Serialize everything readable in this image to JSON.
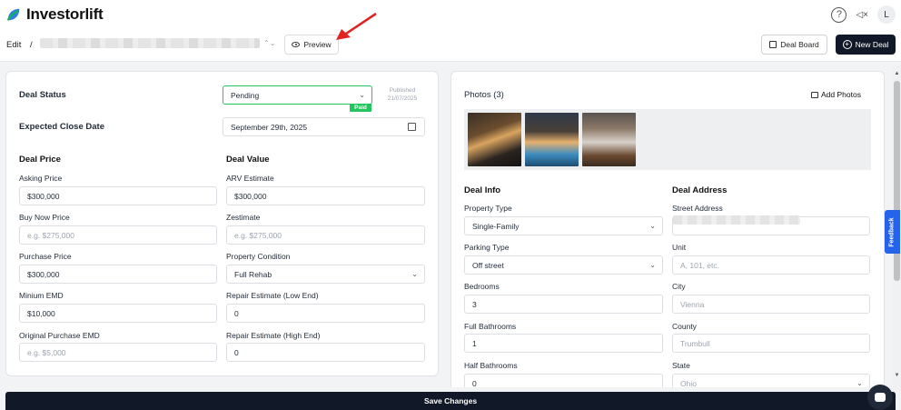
{
  "app": {
    "name": "Investorlift"
  },
  "topbar": {
    "help": "?",
    "mute": "◁×",
    "avatar": "L"
  },
  "subbar": {
    "edit_label": "Edit",
    "slash": "/",
    "preview_label": "Preview",
    "deal_board_label": "Deal Board",
    "new_deal_label": "New Deal",
    "updown": "⌃⌄"
  },
  "left": {
    "deal_status_label": "Deal Status",
    "deal_status_value": "Pending",
    "paid_badge": "Paid",
    "published_label": "Published",
    "published_date": "21/07/2025",
    "close_date_label": "Expected Close Date",
    "close_date_value": "September 29th, 2025",
    "deal_price_heading": "Deal Price",
    "deal_value_heading": "Deal Value",
    "asking_price_label": "Asking Price",
    "asking_price_value": "$300,000",
    "arv_label": "ARV Estimate",
    "arv_value": "$300,000",
    "buy_now_label": "Buy Now Price",
    "buy_now_placeholder": "e.g. $275,000",
    "zestimate_label": "Zestimate",
    "zestimate_placeholder": "e.g. $275,000",
    "purchase_price_label": "Purchase Price",
    "purchase_price_value": "$300,000",
    "condition_label": "Property Condition",
    "condition_value": "Full Rehab",
    "min_emd_label": "Minium EMD",
    "min_emd_value": "$10,000",
    "repair_low_label": "Repair Estimate (Low End)",
    "repair_low_value": "0",
    "orig_emd_label": "Original Purchase EMD",
    "orig_emd_placeholder": "e.g. $5,000",
    "repair_high_label": "Repair Estimate (High End)",
    "repair_high_value": "0"
  },
  "right": {
    "photos_label": "Photos (3)",
    "add_photos_label": "Add Photos",
    "deal_info_heading": "Deal Info",
    "deal_address_heading": "Deal Address",
    "property_type_label": "Property Type",
    "property_type_value": "Single-Family",
    "street_label": "Street Address",
    "parking_label": "Parking Type",
    "parking_value": "Off street",
    "unit_label": "Unit",
    "unit_placeholder": "A, 101, etc.",
    "bedrooms_label": "Bedrooms",
    "bedrooms_value": "3",
    "city_label": "City",
    "city_placeholder": "Vienna",
    "full_bath_label": "Full Bathrooms",
    "full_bath_value": "1",
    "county_label": "County",
    "county_placeholder": "Trumbull",
    "half_bath_label": "Half Bathrooms",
    "half_bath_value": "0",
    "state_label": "State",
    "state_placeholder": "Ohio"
  },
  "feedback_label": "Feedback",
  "save_label": "Save Changes",
  "colors": {
    "accent_green": "#22c55e",
    "dark": "#111827",
    "feedback_blue": "#2563eb",
    "annotation_red": "#e02424"
  }
}
